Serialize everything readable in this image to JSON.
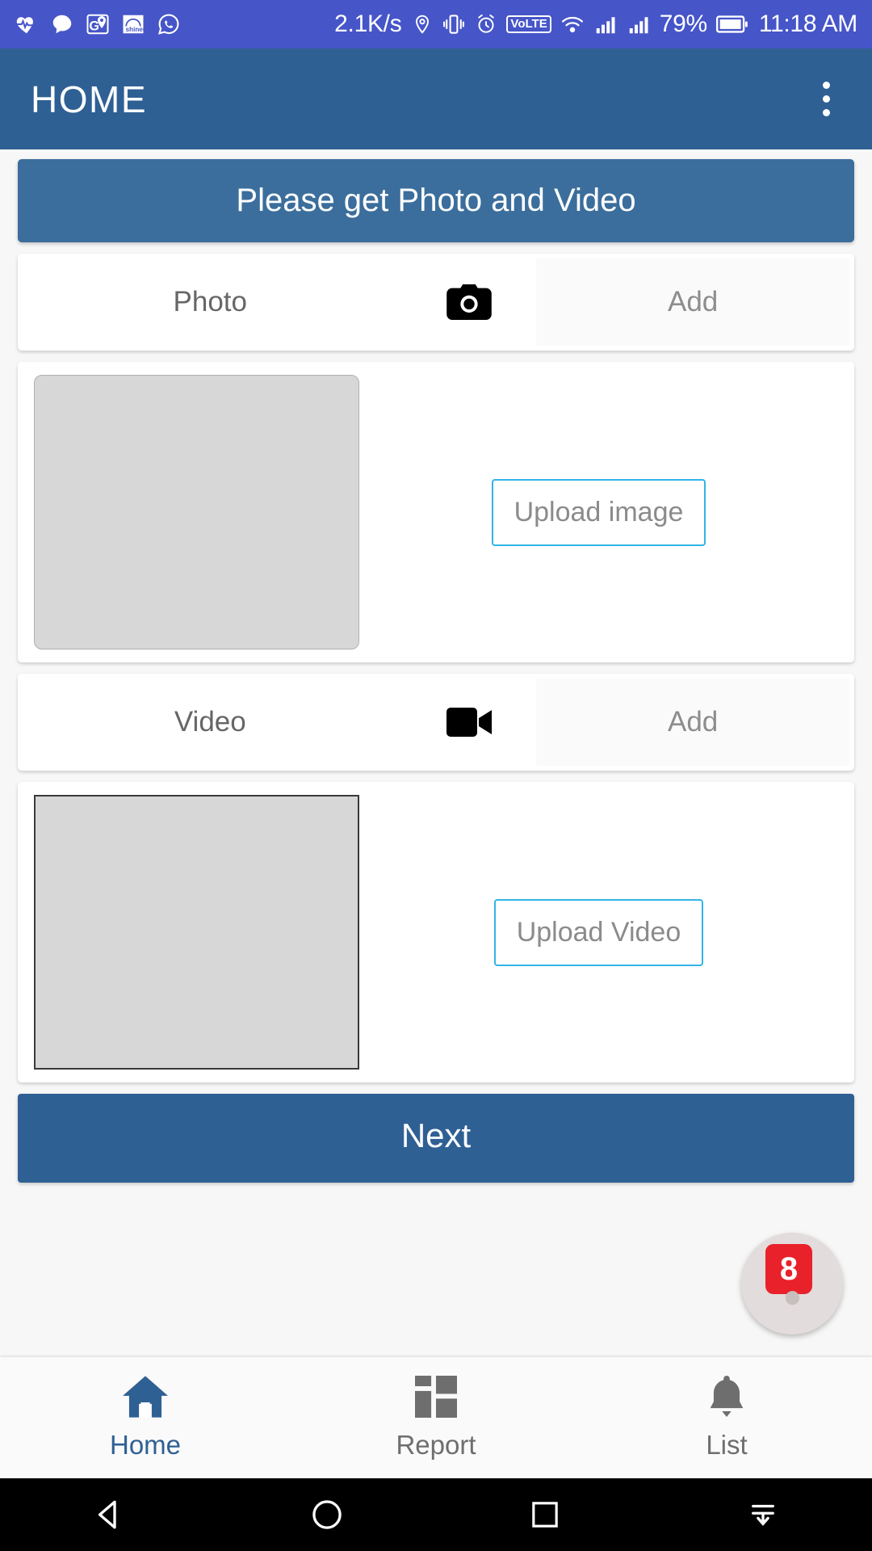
{
  "status_bar": {
    "background": "#4655c8",
    "left_icons": [
      "heart-pulse-icon",
      "chat-bubble-icon",
      "google-maps-icon",
      "shineu-app-icon",
      "whatsapp-icon"
    ],
    "network_speed": "2.1K/s",
    "right_icons": [
      "location-icon",
      "vibrate-icon",
      "alarm-icon"
    ],
    "volte_label": "VoLTE",
    "wifi_icon": "wifi-icon",
    "signal_icons": [
      "signal-bars-icon",
      "signal-bars-icon"
    ],
    "battery_percent": "79%",
    "battery_icon": "battery-icon",
    "clock": "11:18 AM"
  },
  "app_bar": {
    "title": "HOME",
    "background": "#2f6094",
    "overflow_icon": "more-vertical-icon"
  },
  "main": {
    "banner": {
      "text": "Please get Photo and Video",
      "background": "#3b6e9c"
    },
    "photo_row": {
      "label": "Photo",
      "icon": "camera-icon",
      "add_label": "Add"
    },
    "photo_preview": {
      "thumbnail": "image-placeholder",
      "upload_label": "Upload image",
      "upload_border_color": "#33b5e5"
    },
    "video_row": {
      "label": "Video",
      "icon": "video-camera-icon",
      "add_label": "Add"
    },
    "video_preview": {
      "thumbnail": "video-placeholder",
      "upload_label": "Upload Video",
      "upload_border_color": "#33b5e5"
    },
    "next_button": {
      "label": "Next",
      "background": "#2f6094"
    }
  },
  "fab": {
    "badge_count": "8",
    "badge_color": "#e8212a",
    "icon": "assistant-bubble-icon"
  },
  "bottom_nav": {
    "active_color": "#2f6094",
    "inactive_color": "#6e6e6e",
    "items": [
      {
        "label": "Home",
        "icon": "home-icon",
        "active": true
      },
      {
        "label": "Report",
        "icon": "report-grid-icon",
        "active": false
      },
      {
        "label": "List",
        "icon": "bell-icon",
        "active": false
      }
    ]
  },
  "android_nav": {
    "back": "back-triangle-icon",
    "home": "home-circle-icon",
    "recents": "recents-square-icon",
    "hide": "hide-nav-icon"
  }
}
